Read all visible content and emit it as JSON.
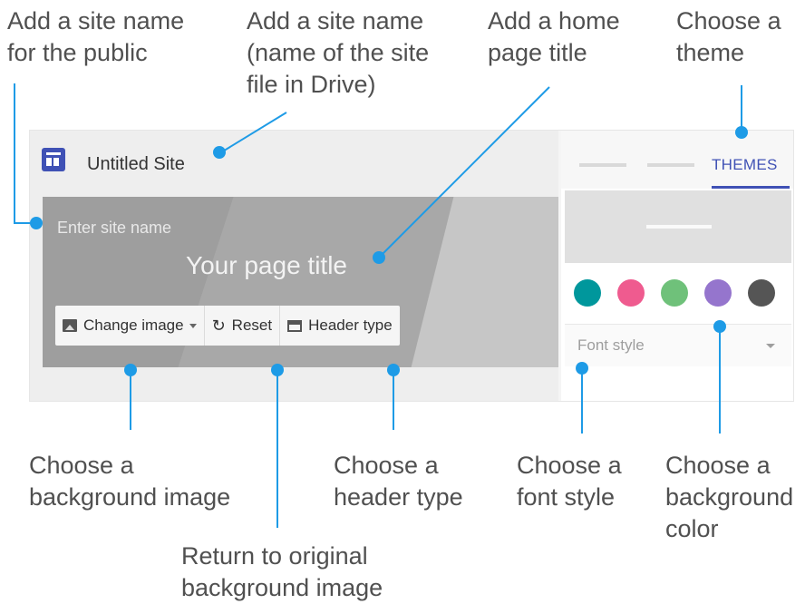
{
  "callouts": {
    "site_name_public": [
      "Add a site name",
      "for the public"
    ],
    "site_name_drive": [
      "Add a site name",
      "(name of the site",
      "file in Drive)"
    ],
    "home_page_title": [
      "Add a home",
      "page title"
    ],
    "choose_theme": [
      "Choose a",
      "theme"
    ],
    "background_image": [
      "Choose a",
      "background image"
    ],
    "original_background": [
      "Return to original",
      "background image"
    ],
    "header_type": [
      "Choose a",
      "header type"
    ],
    "font_style": [
      "Choose a",
      "font style"
    ],
    "background_color": [
      "Choose a",
      "background",
      "color"
    ]
  },
  "editor": {
    "site_title": "Untitled Site",
    "site_name_placeholder": "Enter site name",
    "page_title": "Your page title",
    "toolbar": {
      "change_image": "Change image",
      "reset": "Reset",
      "header_type": "Header type"
    }
  },
  "side_panel": {
    "active_tab": "THEMES",
    "font_style_label": "Font style",
    "swatch_colors": [
      "#00979c",
      "#ef5b8f",
      "#6fc17a",
      "#9575cd",
      "#555555"
    ]
  },
  "colors": {
    "accent": "#3f51b5",
    "callout_dot": "#1e9be6"
  }
}
